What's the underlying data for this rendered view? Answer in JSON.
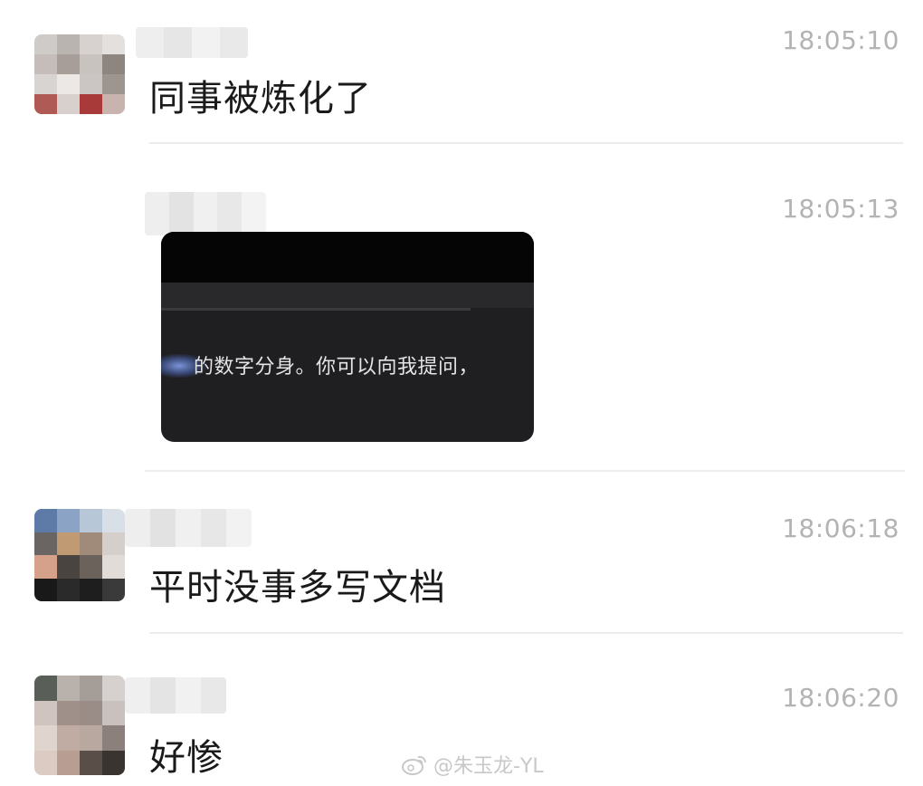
{
  "messages": [
    {
      "time": "18:05:10",
      "text": "同事被炼化了",
      "avatar": "blurred-avatar",
      "sender_name": "blurred-name"
    },
    {
      "time": "18:05:13",
      "image": {
        "caption": "的数字分身。你可以向我提问，"
      },
      "sender_name": "blurred-name"
    },
    {
      "time": "18:06:18",
      "text": "平时没事多写文档",
      "avatar": "blurred-avatar",
      "sender_name": "blurred-name"
    },
    {
      "time": "18:06:20",
      "text": "好惨",
      "avatar": "blurred-avatar",
      "sender_name": "blurred-name"
    }
  ],
  "watermark": {
    "icon": "weibo-icon",
    "text": "@朱玉龙-YL"
  },
  "colors": {
    "time": "#b3b3b3",
    "text": "#1a1a1a",
    "divider": "#ececec",
    "background": "#ffffff"
  }
}
